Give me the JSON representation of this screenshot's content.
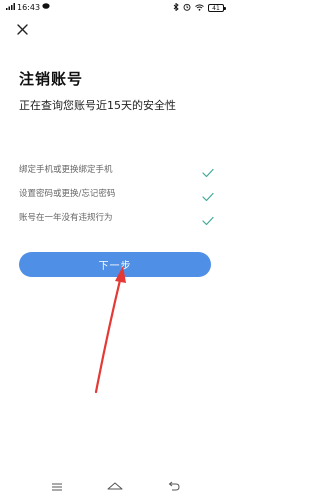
{
  "status_bar": {
    "time": "16:43",
    "battery": "41"
  },
  "page": {
    "title": "注销账号",
    "subtitle": "正在查询您账号近15天的安全性"
  },
  "checks": [
    {
      "label": "绑定手机或更换绑定手机",
      "status": "passed"
    },
    {
      "label": "设置密码或更换/忘记密码",
      "status": "passed"
    },
    {
      "label": "账号在一年没有违规行为",
      "status": "passed"
    }
  ],
  "actions": {
    "next_label": "下一步"
  },
  "colors": {
    "accent": "#4f8fe6",
    "check": "#3fa89a",
    "annotation_arrow": "#e53935"
  },
  "icons": {
    "close": "close-icon",
    "check": "check-icon",
    "nav_menu": "menu-icon",
    "nav_home": "home-icon",
    "nav_back": "back-icon"
  }
}
